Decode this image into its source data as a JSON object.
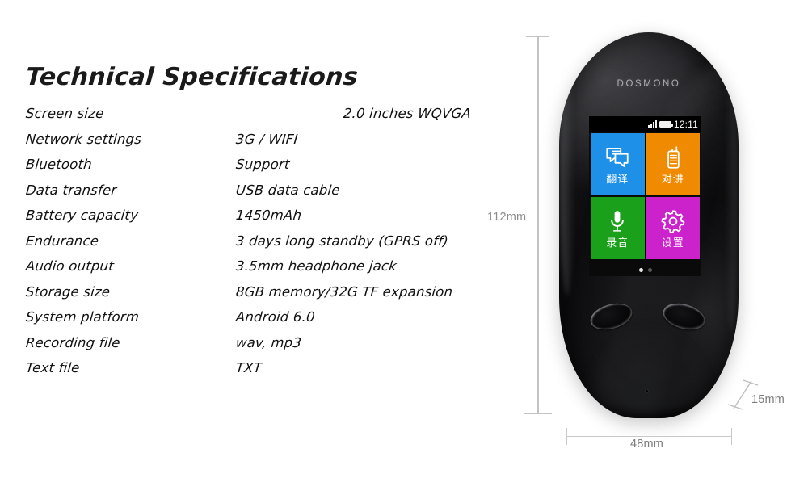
{
  "specifications": {
    "title": "Technical Specifications",
    "rows": [
      {
        "key": "Screen size",
        "value": "2.0 inches WQVGA"
      },
      {
        "key": "Network settings",
        "value": "3G / WIFI"
      },
      {
        "key": "Bluetooth",
        "value": "Support"
      },
      {
        "key": "Data transfer",
        "value": "USB data cable"
      },
      {
        "key": "Battery capacity",
        "value": "1450mAh"
      },
      {
        "key": "Endurance",
        "value": "3 days long standby (GPRS off)"
      },
      {
        "key": "Audio output",
        "value": "3.5mm headphone jack"
      },
      {
        "key": "Storage size",
        "value": "8GB memory/32G TF expansion"
      },
      {
        "key": "System platform",
        "value": "Android 6.0"
      },
      {
        "key": "Recording file",
        "value": "wav, mp3"
      },
      {
        "key": "Text file",
        "value": "TXT"
      }
    ]
  },
  "device": {
    "brand": "DOSMONO",
    "statusbar": {
      "signal_icon": "signal-bars-icon",
      "battery_icon": "battery-full-icon",
      "time": "12:11"
    },
    "tiles": [
      {
        "label": "翻译",
        "icon": "speech-bubbles-icon",
        "color": "#1e90e8"
      },
      {
        "label": "对讲",
        "icon": "walkie-talkie-icon",
        "color": "#f08a00"
      },
      {
        "label": "录音",
        "icon": "microphone-icon",
        "color": "#1aa01a"
      },
      {
        "label": "设置",
        "icon": "gear-icon",
        "color": "#cc22cc"
      }
    ],
    "pager": {
      "total": 2,
      "active": 1
    }
  },
  "dimensions": {
    "height": "112mm",
    "width": "48mm",
    "thickness": "15mm"
  }
}
